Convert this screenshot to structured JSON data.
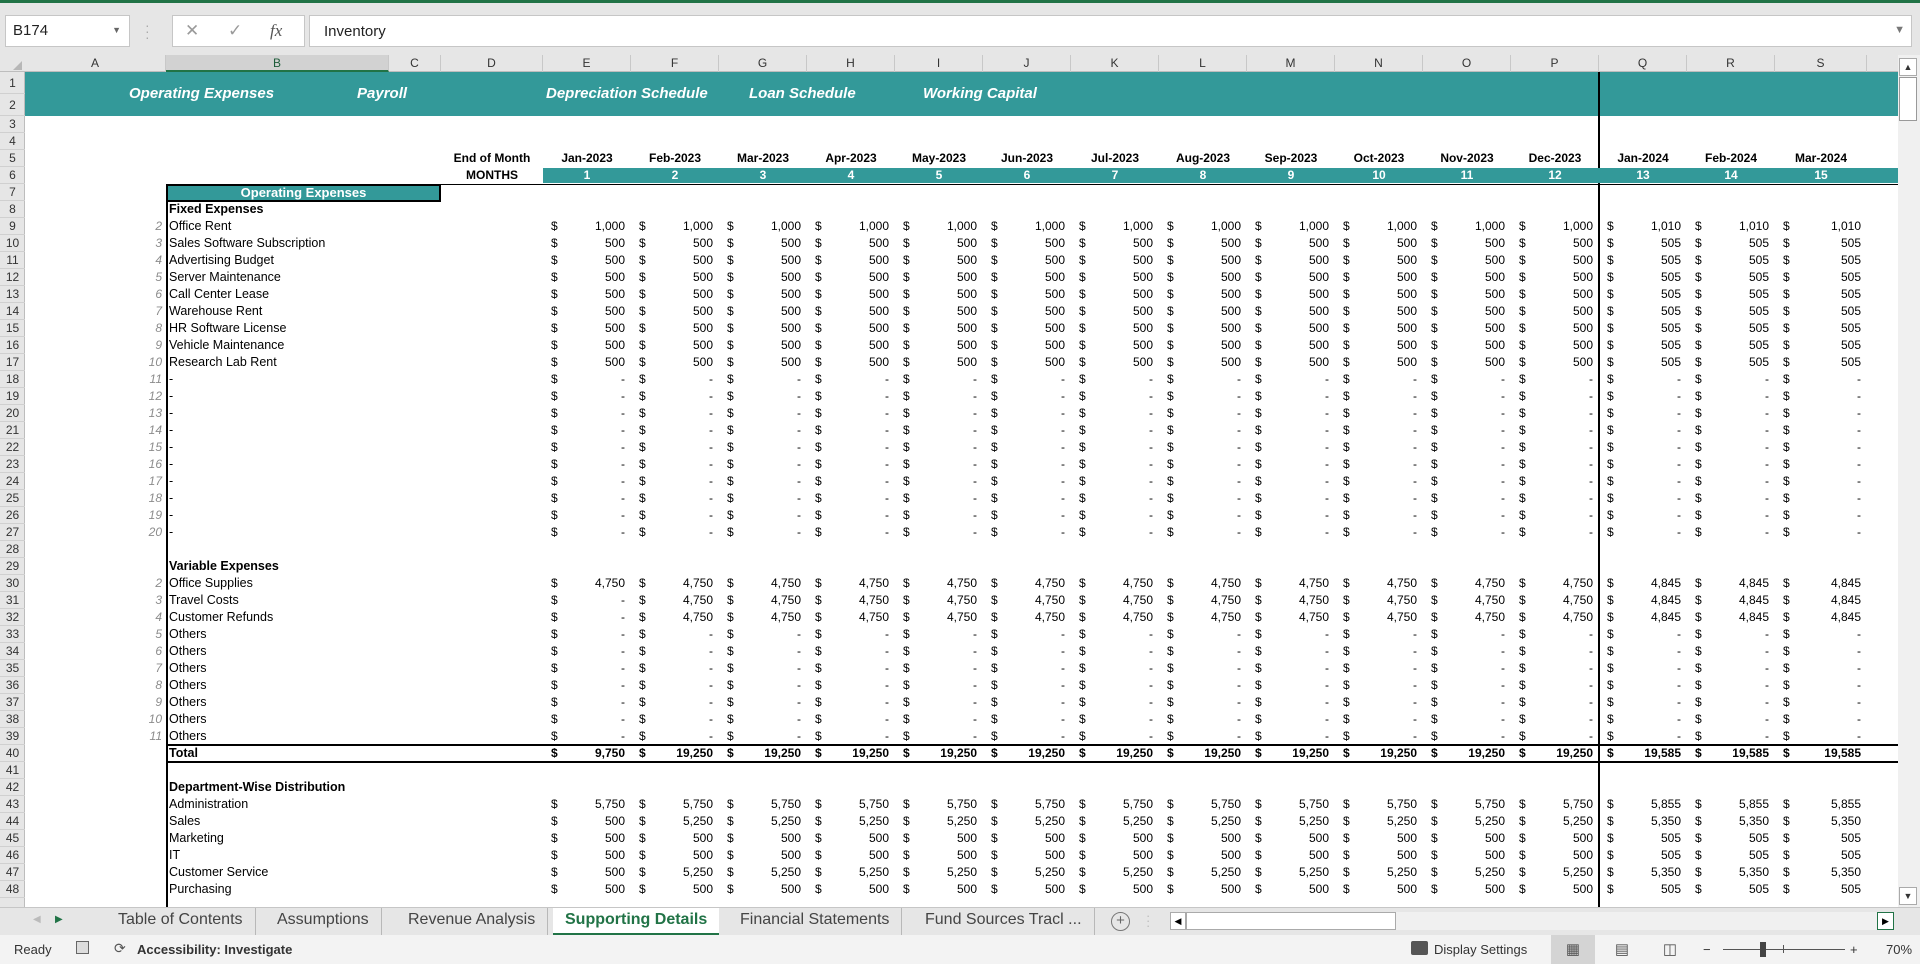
{
  "formula_bar": {
    "name_box": "B174",
    "cancel_icon": "✕",
    "enter_icon": "✓",
    "fx_label": "fx",
    "formula_value": "Inventory"
  },
  "columns": [
    "A",
    "B",
    "C",
    "D",
    "E",
    "F",
    "G",
    "H",
    "I",
    "J",
    "K",
    "L",
    "M",
    "N",
    "O",
    "P",
    "Q",
    "R",
    "S"
  ],
  "selected_column": "B",
  "rows": [
    "1",
    "2",
    "3",
    "4",
    "5",
    "6",
    "7",
    "8",
    "9",
    "10",
    "11",
    "12",
    "13",
    "14",
    "15",
    "16",
    "17",
    "18",
    "19",
    "20",
    "21",
    "22",
    "23",
    "24",
    "25",
    "26",
    "27",
    "28",
    "29",
    "30",
    "31",
    "32",
    "33",
    "34",
    "35",
    "36",
    "37",
    "38",
    "39",
    "40",
    "41",
    "42",
    "43",
    "44",
    "45",
    "46",
    "47",
    "48"
  ],
  "banner": {
    "links": [
      "Operating Expenses",
      "Payroll",
      "Depreciation Schedule",
      "Loan Schedule",
      "Working Capital"
    ]
  },
  "header": {
    "end_of_month_label": "End of Month",
    "months_label": "MONTHS",
    "months": [
      "Jan-2023",
      "Feb-2023",
      "Mar-2023",
      "Apr-2023",
      "May-2023",
      "Jun-2023",
      "Jul-2023",
      "Aug-2023",
      "Sep-2023",
      "Oct-2023",
      "Nov-2023",
      "Dec-2023",
      "Jan-2024",
      "Feb-2024",
      "Mar-2024"
    ],
    "month_numbers": [
      "1",
      "2",
      "3",
      "4",
      "5",
      "6",
      "7",
      "8",
      "9",
      "10",
      "11",
      "12",
      "13",
      "14",
      "15"
    ]
  },
  "section_title": "Operating Expenses",
  "currency_symbol": "$",
  "fixed_expenses": {
    "title": "Fixed Expenses",
    "items": [
      {
        "idx": "2",
        "label": "Office Rent",
        "values": [
          "1,000",
          "1,000",
          "1,000",
          "1,000",
          "1,000",
          "1,000",
          "1,000",
          "1,000",
          "1,000",
          "1,000",
          "1,000",
          "1,000",
          "1,010",
          "1,010",
          "1,010"
        ]
      },
      {
        "idx": "3",
        "label": "Sales Software Subscription",
        "values": [
          "500",
          "500",
          "500",
          "500",
          "500",
          "500",
          "500",
          "500",
          "500",
          "500",
          "500",
          "500",
          "505",
          "505",
          "505"
        ]
      },
      {
        "idx": "4",
        "label": "Advertising Budget",
        "values": [
          "500",
          "500",
          "500",
          "500",
          "500",
          "500",
          "500",
          "500",
          "500",
          "500",
          "500",
          "500",
          "505",
          "505",
          "505"
        ]
      },
      {
        "idx": "5",
        "label": "Server Maintenance",
        "values": [
          "500",
          "500",
          "500",
          "500",
          "500",
          "500",
          "500",
          "500",
          "500",
          "500",
          "500",
          "500",
          "505",
          "505",
          "505"
        ]
      },
      {
        "idx": "6",
        "label": "Call Center Lease",
        "values": [
          "500",
          "500",
          "500",
          "500",
          "500",
          "500",
          "500",
          "500",
          "500",
          "500",
          "500",
          "500",
          "505",
          "505",
          "505"
        ]
      },
      {
        "idx": "7",
        "label": "Warehouse Rent",
        "values": [
          "500",
          "500",
          "500",
          "500",
          "500",
          "500",
          "500",
          "500",
          "500",
          "500",
          "500",
          "500",
          "505",
          "505",
          "505"
        ]
      },
      {
        "idx": "8",
        "label": "HR Software License",
        "values": [
          "500",
          "500",
          "500",
          "500",
          "500",
          "500",
          "500",
          "500",
          "500",
          "500",
          "500",
          "500",
          "505",
          "505",
          "505"
        ]
      },
      {
        "idx": "9",
        "label": "Vehicle Maintenance",
        "values": [
          "500",
          "500",
          "500",
          "500",
          "500",
          "500",
          "500",
          "500",
          "500",
          "500",
          "500",
          "500",
          "505",
          "505",
          "505"
        ]
      },
      {
        "idx": "10",
        "label": "Research Lab Rent",
        "values": [
          "500",
          "500",
          "500",
          "500",
          "500",
          "500",
          "500",
          "500",
          "500",
          "500",
          "500",
          "500",
          "505",
          "505",
          "505"
        ]
      },
      {
        "idx": "11",
        "label": "-",
        "values": [
          "-",
          "-",
          "-",
          "-",
          "-",
          "-",
          "-",
          "-",
          "-",
          "-",
          "-",
          "-",
          "-",
          "-",
          "-"
        ]
      },
      {
        "idx": "12",
        "label": "-",
        "values": [
          "-",
          "-",
          "-",
          "-",
          "-",
          "-",
          "-",
          "-",
          "-",
          "-",
          "-",
          "-",
          "-",
          "-",
          "-"
        ]
      },
      {
        "idx": "13",
        "label": "-",
        "values": [
          "-",
          "-",
          "-",
          "-",
          "-",
          "-",
          "-",
          "-",
          "-",
          "-",
          "-",
          "-",
          "-",
          "-",
          "-"
        ]
      },
      {
        "idx": "14",
        "label": "-",
        "values": [
          "-",
          "-",
          "-",
          "-",
          "-",
          "-",
          "-",
          "-",
          "-",
          "-",
          "-",
          "-",
          "-",
          "-",
          "-"
        ]
      },
      {
        "idx": "15",
        "label": "-",
        "values": [
          "-",
          "-",
          "-",
          "-",
          "-",
          "-",
          "-",
          "-",
          "-",
          "-",
          "-",
          "-",
          "-",
          "-",
          "-"
        ]
      },
      {
        "idx": "16",
        "label": "-",
        "values": [
          "-",
          "-",
          "-",
          "-",
          "-",
          "-",
          "-",
          "-",
          "-",
          "-",
          "-",
          "-",
          "-",
          "-",
          "-"
        ]
      },
      {
        "idx": "17",
        "label": "-",
        "values": [
          "-",
          "-",
          "-",
          "-",
          "-",
          "-",
          "-",
          "-",
          "-",
          "-",
          "-",
          "-",
          "-",
          "-",
          "-"
        ]
      },
      {
        "idx": "18",
        "label": "-",
        "values": [
          "-",
          "-",
          "-",
          "-",
          "-",
          "-",
          "-",
          "-",
          "-",
          "-",
          "-",
          "-",
          "-",
          "-",
          "-"
        ]
      },
      {
        "idx": "19",
        "label": "-",
        "values": [
          "-",
          "-",
          "-",
          "-",
          "-",
          "-",
          "-",
          "-",
          "-",
          "-",
          "-",
          "-",
          "-",
          "-",
          "-"
        ]
      },
      {
        "idx": "20",
        "label": "-",
        "values": [
          "-",
          "-",
          "-",
          "-",
          "-",
          "-",
          "-",
          "-",
          "-",
          "-",
          "-",
          "-",
          "-",
          "-",
          "-"
        ]
      }
    ]
  },
  "variable_expenses": {
    "title": "Variable Expenses",
    "items": [
      {
        "idx": "2",
        "label": "Office Supplies",
        "values": [
          "4,750",
          "4,750",
          "4,750",
          "4,750",
          "4,750",
          "4,750",
          "4,750",
          "4,750",
          "4,750",
          "4,750",
          "4,750",
          "4,750",
          "4,845",
          "4,845",
          "4,845"
        ]
      },
      {
        "idx": "3",
        "label": "Travel Costs",
        "values": [
          "-",
          "4,750",
          "4,750",
          "4,750",
          "4,750",
          "4,750",
          "4,750",
          "4,750",
          "4,750",
          "4,750",
          "4,750",
          "4,750",
          "4,845",
          "4,845",
          "4,845"
        ]
      },
      {
        "idx": "4",
        "label": "Customer Refunds",
        "values": [
          "-",
          "4,750",
          "4,750",
          "4,750",
          "4,750",
          "4,750",
          "4,750",
          "4,750",
          "4,750",
          "4,750",
          "4,750",
          "4,750",
          "4,845",
          "4,845",
          "4,845"
        ]
      },
      {
        "idx": "5",
        "label": "Others",
        "values": [
          "-",
          "-",
          "-",
          "-",
          "-",
          "-",
          "-",
          "-",
          "-",
          "-",
          "-",
          "-",
          "-",
          "-",
          "-"
        ]
      },
      {
        "idx": "6",
        "label": "Others",
        "values": [
          "-",
          "-",
          "-",
          "-",
          "-",
          "-",
          "-",
          "-",
          "-",
          "-",
          "-",
          "-",
          "-",
          "-",
          "-"
        ]
      },
      {
        "idx": "7",
        "label": "Others",
        "values": [
          "-",
          "-",
          "-",
          "-",
          "-",
          "-",
          "-",
          "-",
          "-",
          "-",
          "-",
          "-",
          "-",
          "-",
          "-"
        ]
      },
      {
        "idx": "8",
        "label": "Others",
        "values": [
          "-",
          "-",
          "-",
          "-",
          "-",
          "-",
          "-",
          "-",
          "-",
          "-",
          "-",
          "-",
          "-",
          "-",
          "-"
        ]
      },
      {
        "idx": "9",
        "label": "Others",
        "values": [
          "-",
          "-",
          "-",
          "-",
          "-",
          "-",
          "-",
          "-",
          "-",
          "-",
          "-",
          "-",
          "-",
          "-",
          "-"
        ]
      },
      {
        "idx": "10",
        "label": "Others",
        "values": [
          "-",
          "-",
          "-",
          "-",
          "-",
          "-",
          "-",
          "-",
          "-",
          "-",
          "-",
          "-",
          "-",
          "-",
          "-"
        ]
      },
      {
        "idx": "11",
        "label": "Others",
        "values": [
          "-",
          "-",
          "-",
          "-",
          "-",
          "-",
          "-",
          "-",
          "-",
          "-",
          "-",
          "-",
          "-",
          "-",
          "-"
        ]
      }
    ]
  },
  "total": {
    "label": "Total",
    "values": [
      "9,750",
      "19,250",
      "19,250",
      "19,250",
      "19,250",
      "19,250",
      "19,250",
      "19,250",
      "19,250",
      "19,250",
      "19,250",
      "19,250",
      "19,585",
      "19,585",
      "19,585"
    ]
  },
  "department_distribution": {
    "title": "Department-Wise Distribution",
    "items": [
      {
        "label": "Administration",
        "values": [
          "5,750",
          "5,750",
          "5,750",
          "5,750",
          "5,750",
          "5,750",
          "5,750",
          "5,750",
          "5,750",
          "5,750",
          "5,750",
          "5,750",
          "5,855",
          "5,855",
          "5,855"
        ]
      },
      {
        "label": "Sales",
        "values": [
          "500",
          "5,250",
          "5,250",
          "5,250",
          "5,250",
          "5,250",
          "5,250",
          "5,250",
          "5,250",
          "5,250",
          "5,250",
          "5,250",
          "5,350",
          "5,350",
          "5,350"
        ]
      },
      {
        "label": "Marketing",
        "values": [
          "500",
          "500",
          "500",
          "500",
          "500",
          "500",
          "500",
          "500",
          "500",
          "500",
          "500",
          "500",
          "505",
          "505",
          "505"
        ]
      },
      {
        "label": "IT",
        "values": [
          "500",
          "500",
          "500",
          "500",
          "500",
          "500",
          "500",
          "500",
          "500",
          "500",
          "500",
          "500",
          "505",
          "505",
          "505"
        ]
      },
      {
        "label": "Customer Service",
        "values": [
          "500",
          "5,250",
          "5,250",
          "5,250",
          "5,250",
          "5,250",
          "5,250",
          "5,250",
          "5,250",
          "5,250",
          "5,250",
          "5,250",
          "5,350",
          "5,350",
          "5,350"
        ]
      },
      {
        "label": "Purchasing",
        "values": [
          "500",
          "500",
          "500",
          "500",
          "500",
          "500",
          "500",
          "500",
          "500",
          "500",
          "500",
          "500",
          "505",
          "505",
          "505"
        ]
      }
    ]
  },
  "sheet_tabs": {
    "tabs": [
      "Table of Contents",
      "Assumptions",
      "Revenue Analysis",
      "Supporting Details",
      "Financial Statements",
      "Fund Sources Tracl ..."
    ],
    "active": "Supporting Details",
    "add_sheet_icon": "+"
  },
  "status_bar": {
    "ready": "Ready",
    "accessibility": "Accessibility: Investigate",
    "display_settings": "Display Settings",
    "zoom_level": "70%",
    "zoom_fraction": 0.7,
    "zoom_minus": "−",
    "zoom_plus": "+"
  }
}
